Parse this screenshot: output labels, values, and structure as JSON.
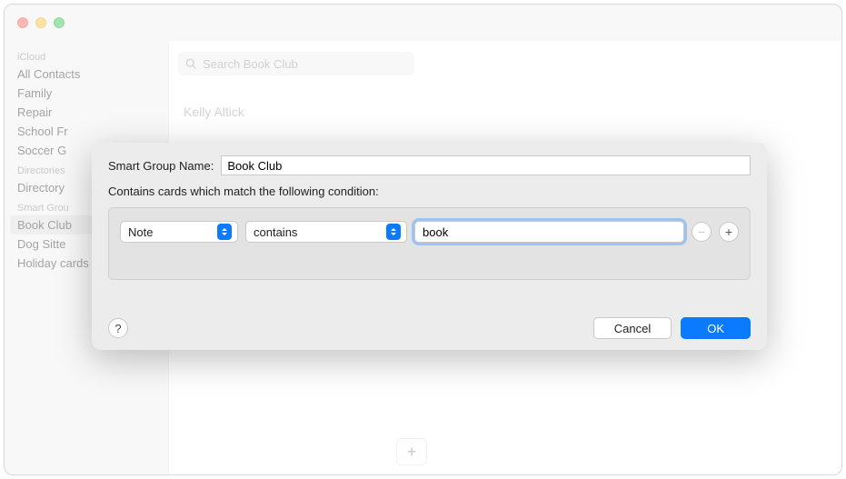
{
  "sidebar": {
    "sections": [
      {
        "label": "iCloud",
        "items": [
          {
            "label": "All Contacts"
          },
          {
            "label": "Family"
          },
          {
            "label": "Repair"
          },
          {
            "label": "School Fr"
          },
          {
            "label": "Soccer G"
          }
        ]
      },
      {
        "label": "Directories",
        "items": [
          {
            "label": "Directory"
          }
        ]
      },
      {
        "label": "Smart Grou",
        "items": [
          {
            "label": "Book Club",
            "selected": true
          },
          {
            "label": "Dog Sitte"
          },
          {
            "label": "Holiday cards"
          }
        ]
      }
    ]
  },
  "search": {
    "placeholder": "Search Book Club"
  },
  "contacts": {
    "first": "Kelly Altick"
  },
  "sheet": {
    "name_label": "Smart Group Name:",
    "name_value": "Book Club",
    "prompt": "Contains cards which match the following condition:",
    "field": "Note",
    "operator": "contains",
    "value": "book",
    "remove_glyph": "−",
    "add_glyph": "+",
    "help_glyph": "?",
    "cancel": "Cancel",
    "ok": "OK"
  },
  "icons": {
    "add": "+"
  }
}
